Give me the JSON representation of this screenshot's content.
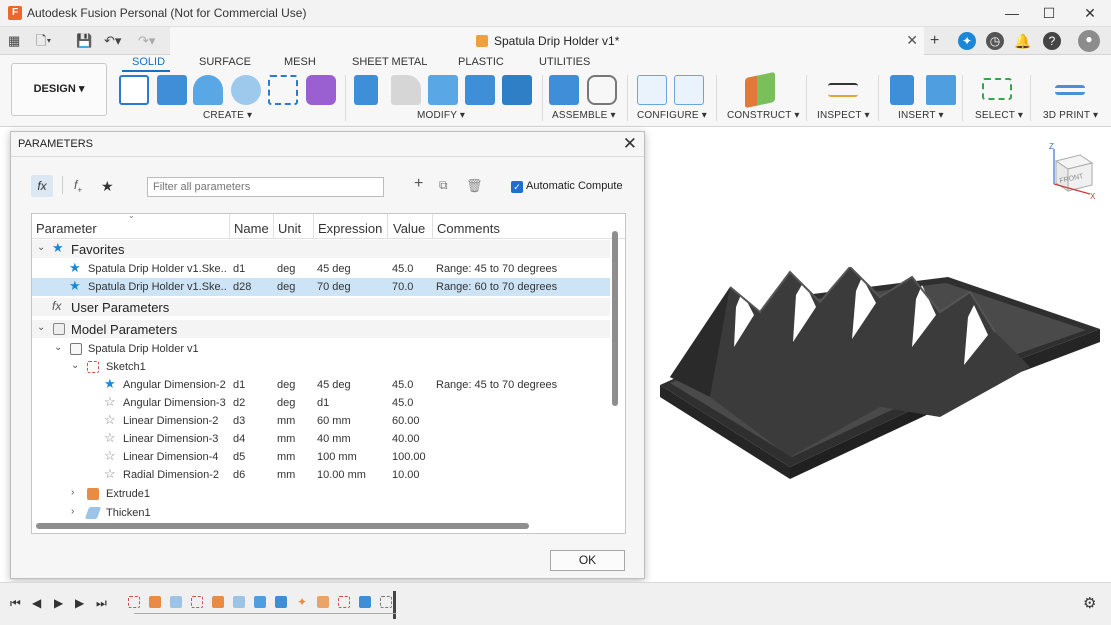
{
  "window": {
    "title": "Autodesk Fusion Personal (Not for Commercial Use)",
    "logo_letter": "F",
    "minimize": "—",
    "maximize": "☐",
    "close": "✕"
  },
  "document": {
    "title": "Spatula Drip Holder v1*",
    "close": "✕"
  },
  "toolbar": {
    "workspace": "DESIGN ▾",
    "tabs": [
      "SOLID",
      "SURFACE",
      "MESH",
      "SHEET METAL",
      "PLASTIC",
      "UTILITIES"
    ],
    "groups": [
      "CREATE ▾",
      "MODIFY ▾",
      "ASSEMBLE ▾",
      "CONFIGURE ▾",
      "CONSTRUCT ▾",
      "INSPECT ▾",
      "INSERT ▾",
      "SELECT ▾",
      "3D PRINT ▾"
    ]
  },
  "dialog": {
    "title": "PARAMETERS",
    "close": "✕",
    "filter_placeholder": "Filter all parameters",
    "auto_compute_label": "Automatic Compute",
    "auto_compute_checked": true,
    "ok_label": "OK",
    "columns": [
      "Parameter",
      "Name",
      "Unit",
      "Expression",
      "Value",
      "Comments"
    ],
    "groups": {
      "favorites": "Favorites",
      "user": "User Parameters",
      "model": "Model Parameters"
    },
    "favorites": [
      {
        "param": "Spatula Drip Holder v1.Ske...",
        "name": "d1",
        "unit": "deg",
        "expr": "45 deg",
        "value": "45.0",
        "comment": "Range: 45 to 70 degrees"
      },
      {
        "param": "Spatula Drip Holder v1.Ske...",
        "name": "d28",
        "unit": "deg",
        "expr": "70 deg",
        "value": "70.0",
        "comment": "Range: 60 to 70 degrees"
      }
    ],
    "component": "Spatula Drip Holder v1",
    "sketch": "Sketch1",
    "sketch_rows": [
      {
        "param": "Angular Dimension-2",
        "name": "d1",
        "unit": "deg",
        "expr": "45 deg",
        "value": "45.0",
        "comment": "Range: 45 to 70 degrees",
        "fav": true
      },
      {
        "param": "Angular Dimension-3",
        "name": "d2",
        "unit": "deg",
        "expr": "d1",
        "value": "45.0",
        "comment": "",
        "fav": false
      },
      {
        "param": "Linear Dimension-2",
        "name": "d3",
        "unit": "mm",
        "expr": "60 mm",
        "value": "60.00",
        "comment": "",
        "fav": false
      },
      {
        "param": "Linear Dimension-3",
        "name": "d4",
        "unit": "mm",
        "expr": "40 mm",
        "value": "40.00",
        "comment": "",
        "fav": false
      },
      {
        "param": "Linear Dimension-4",
        "name": "d5",
        "unit": "mm",
        "expr": "100 mm",
        "value": "100.00",
        "comment": "",
        "fav": false
      },
      {
        "param": "Radial Dimension-2",
        "name": "d6",
        "unit": "mm",
        "expr": "10.00 mm",
        "value": "10.00",
        "comment": "",
        "fav": false
      }
    ],
    "features": [
      "Extrude1",
      "Thicken1"
    ]
  },
  "viewcube": {
    "face": "FRONT",
    "axis_z": "Z",
    "axis_x": "X"
  },
  "colors": {
    "accent": "#1a6fc2",
    "star": "#1b87d6",
    "selection": "#cde4f7",
    "model": "#3d3d3d"
  }
}
